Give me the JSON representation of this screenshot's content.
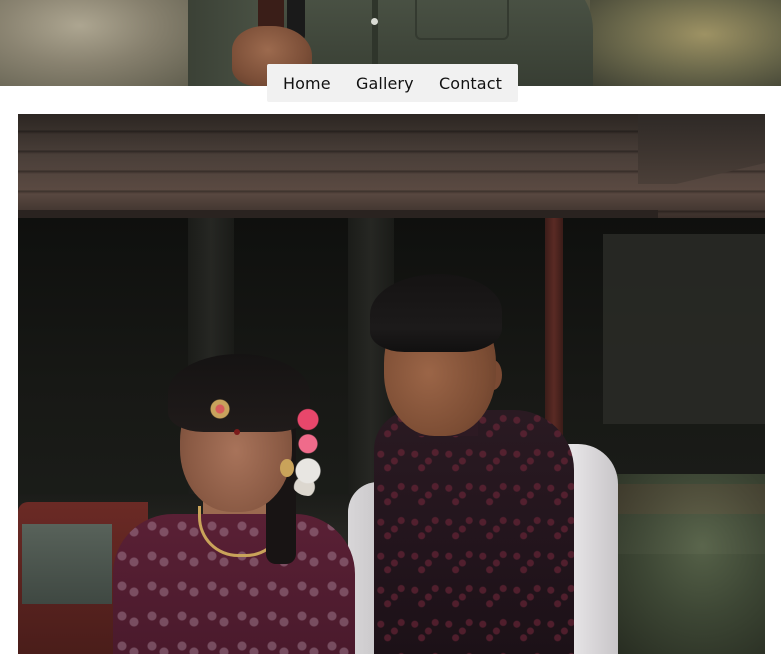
{
  "nav": {
    "items": [
      {
        "label": "Home"
      },
      {
        "label": "Gallery"
      },
      {
        "label": "Contact"
      }
    ]
  },
  "colors": {
    "nav_background": "#f1f1f1",
    "nav_text": "#111111",
    "page_background": "#ffffff"
  },
  "images": {
    "hero_top": "photo of man in olive shirt holding a camera",
    "main_photo": "couple portrait in front of a tiled-roof house"
  }
}
